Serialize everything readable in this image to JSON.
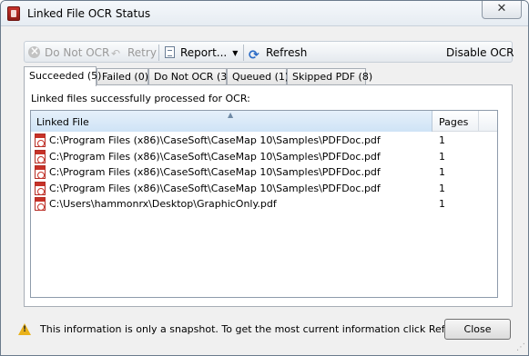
{
  "window": {
    "title": "Linked File OCR Status",
    "close_glyph": "✕"
  },
  "toolbar": {
    "do_not_ocr": "Do Not OCR",
    "retry": "Retry",
    "report": "Report...",
    "refresh": "Refresh",
    "disable_ocr": "Disable OCR"
  },
  "tabs": [
    {
      "label": "Succeeded (5)",
      "active": true
    },
    {
      "label": "Failed (0)"
    },
    {
      "label": "Do Not OCR (3)"
    },
    {
      "label": "Queued (1)"
    },
    {
      "label": "Skipped PDF (8)"
    }
  ],
  "panel": {
    "label": "Linked files successfully processed for OCR:"
  },
  "grid": {
    "columns": [
      "Linked File",
      "Pages"
    ],
    "rows": [
      {
        "file": "C:\\Program Files (x86)\\CaseSoft\\CaseMap 10\\Samples\\PDFDoc.pdf",
        "pages": "1"
      },
      {
        "file": "C:\\Program Files (x86)\\CaseSoft\\CaseMap 10\\Samples\\PDFDoc.pdf",
        "pages": "1"
      },
      {
        "file": "C:\\Program Files (x86)\\CaseSoft\\CaseMap 10\\Samples\\PDFDoc.pdf",
        "pages": "1"
      },
      {
        "file": "C:\\Program Files (x86)\\CaseSoft\\CaseMap 10\\Samples\\PDFDoc.pdf",
        "pages": "1"
      },
      {
        "file": "C:\\Users\\hammonrx\\Desktop\\GraphicOnly.pdf",
        "pages": "1"
      }
    ]
  },
  "footer": {
    "message": "This information is only a snapshot.  To get the most current information click Refresh.",
    "close_label": "Close"
  },
  "icons": {
    "app": "pdf-document-icon",
    "warning": "warning-icon",
    "refresh": "refresh-icon",
    "report": "report-icon",
    "do_not_ocr": "not-allowed-icon",
    "retry": "retry-icon",
    "row": "pdf-file-icon"
  },
  "colors": {
    "accent": "#2a6bc6",
    "header_selected": "#cfe3f6",
    "pdf_red": "#c73228",
    "warning": "#e9b21b"
  }
}
